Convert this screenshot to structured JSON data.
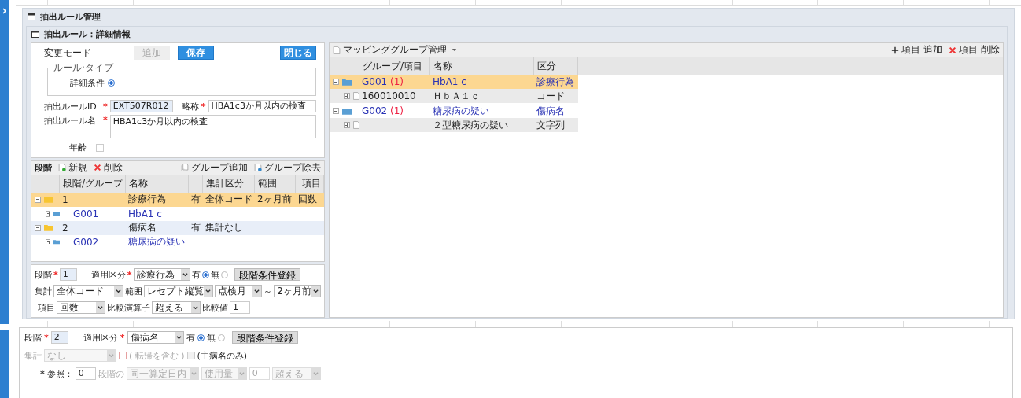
{
  "outer_title": "抽出ルール管理",
  "inner_title": "抽出ルール：詳細情報",
  "form": {
    "mode_label": "変更モード",
    "buttons": [
      {
        "label": "追加",
        "disabled": true,
        "kind": "add"
      },
      {
        "label": "保存",
        "disabled": false,
        "kind": "save"
      },
      {
        "label": "閉じる",
        "disabled": false,
        "kind": "close"
      }
    ],
    "rule_type": {
      "legend": "ルール·タイプ",
      "options": [
        {
          "label": "詳細条件",
          "selected": true
        }
      ]
    },
    "rule_id": {
      "label": "抽出ルールID",
      "required_mark": "*",
      "value": "EXT507R012"
    },
    "short_name": {
      "label": "略称",
      "required_mark": "*",
      "value": "HBA1c3か月以内の検査"
    },
    "rule_name": {
      "label": "抽出ルール名",
      "required_mark": "*",
      "value": "HBA1c3か月以内の検査"
    },
    "age": {
      "label": "年齢",
      "checked": false
    }
  },
  "stage_grid": {
    "title": "段階",
    "tools": [
      {
        "label": "新規",
        "kind": "new"
      },
      {
        "label": "削除",
        "kind": "delete"
      },
      {
        "label": "グループ追加",
        "kind": "group-add"
      },
      {
        "label": "グループ除去",
        "kind": "group-remove"
      }
    ],
    "columns": [
      "段階/グループ",
      "名称",
      "集計区分",
      "範囲",
      "項目"
    ],
    "rows": [
      {
        "stage": "1",
        "name": "診療行為",
        "flag": "有",
        "aggregate": "全体コード",
        "range": "2ヶ月前",
        "item": "回数",
        "selected": true,
        "expanded": true,
        "children": [
          {
            "id": "G001",
            "name": "HbA1 c",
            "expanded": false
          }
        ]
      },
      {
        "stage": "2",
        "name": "傷病名",
        "flag": "有",
        "aggregate": "集計なし",
        "selected": false,
        "expanded": true,
        "children": [
          {
            "id": "G002",
            "name": "糖尿病の疑い",
            "expanded": false
          }
        ]
      }
    ]
  },
  "stage_form_1": {
    "stage_label": "段階",
    "required_mark": "*",
    "stage": "1",
    "apply_label": "適用区分",
    "apply": "診療行為",
    "radios": [
      {
        "label": "有",
        "selected": true
      },
      {
        "label": "無",
        "selected": false
      }
    ],
    "register": "段階条件登録",
    "aggregate_label": "集計",
    "aggregate": "全体コード",
    "range_label": "範囲",
    "range": "レセプト縦覧",
    "range_from": "点検月",
    "tilde": "～",
    "range_to": "2ヶ月前",
    "item_label": "項目",
    "item": "回数",
    "operator_label": "比較演算子",
    "operator": "超える",
    "compare_label": "比較値",
    "compare": "1"
  },
  "stage_form_2": {
    "stage_label": "段階",
    "required_mark": "*",
    "stage": "2",
    "apply_label": "適用区分",
    "apply": "傷病名",
    "radios": [
      {
        "label": "有",
        "selected": true
      },
      {
        "label": "無",
        "selected": false
      }
    ],
    "register": "段階条件登録",
    "aggregate_label": "集計",
    "aggregate": "なし",
    "disabled": true,
    "checks": [
      {
        "label": "( 転帰を含む )",
        "checked": false,
        "disabled": true
      },
      {
        "label": "(主病名のみ)",
        "checked": false,
        "disabled": false
      }
    ],
    "ref_label": "参照：",
    "ref_mark": "*",
    "ref": "0",
    "stage_of": "段階の",
    "same_day": "同一算定日内",
    "usage": "使用量",
    "amount": "0",
    "operator": "超える"
  },
  "mapping": {
    "title": "マッピンググループ管理",
    "actions": [
      {
        "label": "項目 追加",
        "kind": "add"
      },
      {
        "label": "項目 削除",
        "kind": "delete"
      }
    ],
    "columns": [
      "グループ/項目",
      "名称",
      "区分"
    ],
    "rows": [
      {
        "id": "G001",
        "count": "(1)",
        "name": "HbA1 c",
        "category": "診療行為",
        "selected": true,
        "expanded": true,
        "children": [
          {
            "code": "160010010",
            "name": "ＨｂＡ１ｃ",
            "category": "コード",
            "expanded": false
          }
        ]
      },
      {
        "id": "G002",
        "count": "(1)",
        "name": "糖尿病の疑い",
        "category": "傷病名",
        "selected": false,
        "expanded": true,
        "children": [
          {
            "name": "２型糖尿病の疑い",
            "category": "文字列",
            "expanded": false
          }
        ]
      }
    ]
  }
}
